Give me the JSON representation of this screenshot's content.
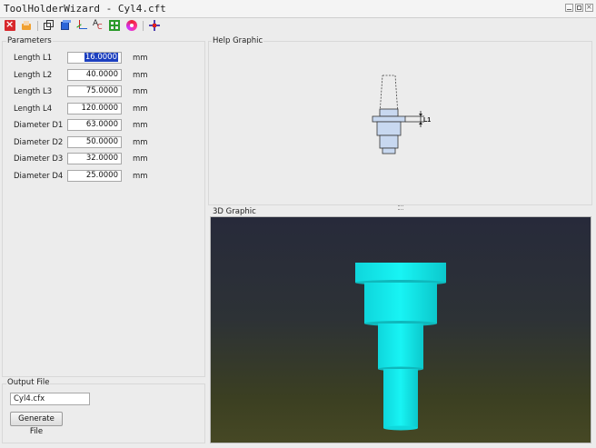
{
  "window": {
    "title": "ToolHolderWizard - Cyl4.cft"
  },
  "toolbar": {
    "icons": [
      "close-icon",
      "save-icon",
      "view-front-icon",
      "view-iso-icon",
      "axis-icon",
      "text-orientation-icon",
      "grid-icon",
      "color-wheel-icon",
      "move-icon"
    ]
  },
  "parameters": {
    "title": "Parameters",
    "rows": [
      {
        "label": "Length L1",
        "value": "16.0000",
        "unit": "mm"
      },
      {
        "label": "Length L2",
        "value": "40.0000",
        "unit": "mm"
      },
      {
        "label": "Length L3",
        "value": "75.0000",
        "unit": "mm"
      },
      {
        "label": "Length L4",
        "value": "120.0000",
        "unit": "mm"
      },
      {
        "label": "Diameter D1",
        "value": "63.0000",
        "unit": "mm"
      },
      {
        "label": "Diameter D2",
        "value": "50.0000",
        "unit": "mm"
      },
      {
        "label": "Diameter D3",
        "value": "32.0000",
        "unit": "mm"
      },
      {
        "label": "Diameter D4",
        "value": "25.0000",
        "unit": "mm"
      }
    ]
  },
  "output": {
    "title": "Output File",
    "filename": "Cyl4.cfx",
    "generate_label": "Generate File"
  },
  "help": {
    "title": "Help Graphic",
    "dimension_label": "L1"
  },
  "view3d": {
    "title": "3D Graphic",
    "model_color": "#10e8e8"
  }
}
